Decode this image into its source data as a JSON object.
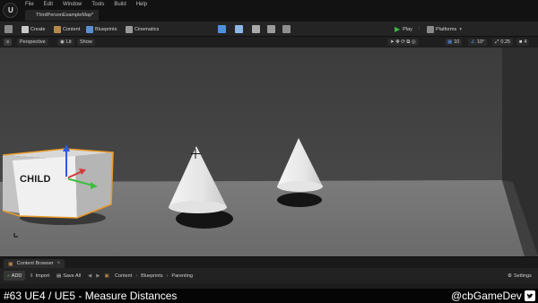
{
  "menu": [
    "File",
    "Edit",
    "Window",
    "Tools",
    "Build",
    "Help"
  ],
  "document_tab": "ThirdPersonExampleMap*",
  "toolbar": {
    "create": "Create",
    "content": "Content",
    "blueprints": "Blueprints",
    "cinematics": "Cinematics",
    "play": "Play",
    "platforms": "Platforms"
  },
  "viewport_bar": {
    "perspective": "Perspective",
    "lit": "Lit",
    "show": "Show",
    "grid_snap": "10",
    "rotation_snap": "10°",
    "scale_snap": "0.25",
    "camera_speed": "4"
  },
  "scene": {
    "cube_label": "CHILD",
    "cube_outline_color": "#e89a2a"
  },
  "content_browser": {
    "tab_label": "Content Browser",
    "add": "ADD",
    "import": "Import",
    "save_all": "Save All",
    "breadcrumb": [
      "Content",
      "Blueprints",
      "Parenting"
    ],
    "settings": "Settings"
  },
  "banner": {
    "title": "#63 UE4 / UE5 - Measure Distances",
    "handle": "@cbGameDev"
  }
}
